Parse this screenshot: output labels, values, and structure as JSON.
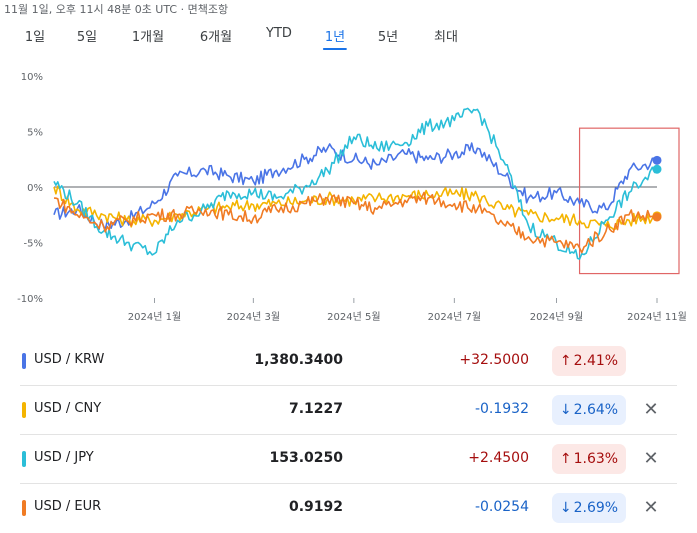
{
  "header": {
    "timestamp": "11월 1일, 오후 11시 48분 0초 UTC · 면책조항"
  },
  "tabs": [
    {
      "label": "1일",
      "active": false
    },
    {
      "label": "5일",
      "active": false
    },
    {
      "label": "1개월",
      "active": false
    },
    {
      "label": "6개월",
      "active": false
    },
    {
      "label": "YTD",
      "active": false
    },
    {
      "label": "1년",
      "active": true
    },
    {
      "label": "5년",
      "active": false
    },
    {
      "label": "최대",
      "active": false
    }
  ],
  "colors": {
    "krw": "#4a74e6",
    "cny": "#f4b400",
    "jpy": "#2bbed8",
    "eur": "#f07b24",
    "highlight_box": "#e06666",
    "up": "#a50e0e",
    "down": "#1a63c7"
  },
  "chart_data": {
    "type": "line",
    "y_unit": "%",
    "ylim": [
      -10,
      10
    ],
    "y_ticks": [
      "10%",
      "5%",
      "0%",
      "-5%",
      "-10%"
    ],
    "x_start": "2023-11-01",
    "x_end": "2024-11-01",
    "x_ticks": [
      "2024년 1월",
      "2024년 3월",
      "2024년 5월",
      "2024년 7월",
      "2024년 9월",
      "2024년 11월"
    ],
    "zero_line": true,
    "highlight_range": [
      "2024-09-15",
      "2024-11-01"
    ],
    "series": [
      {
        "name": "USD / KRW",
        "color": "#4a74e6",
        "x": [
          "2023-11-01",
          "2023-11-15",
          "2023-12-01",
          "2023-12-15",
          "2024-01-01",
          "2024-01-15",
          "2024-02-01",
          "2024-02-15",
          "2024-03-01",
          "2024-03-15",
          "2024-04-01",
          "2024-04-15",
          "2024-05-01",
          "2024-05-15",
          "2024-06-01",
          "2024-06-15",
          "2024-07-01",
          "2024-07-15",
          "2024-08-01",
          "2024-08-15",
          "2024-09-01",
          "2024-09-15",
          "2024-10-01",
          "2024-10-15",
          "2024-11-01"
        ],
        "y": [
          -2.5,
          -2.0,
          -3.5,
          -3.0,
          -1.5,
          1.0,
          1.5,
          1.0,
          0.5,
          1.5,
          2.5,
          3.5,
          2.5,
          2.0,
          3.0,
          2.5,
          3.0,
          3.5,
          1.0,
          -1.0,
          -0.5,
          -1.5,
          -2.0,
          1.5,
          2.4
        ]
      },
      {
        "name": "USD / CNY",
        "color": "#f4b400",
        "x": [
          "2023-11-01",
          "2023-11-15",
          "2023-12-01",
          "2023-12-15",
          "2024-01-01",
          "2024-01-15",
          "2024-02-01",
          "2024-02-15",
          "2024-03-01",
          "2024-03-15",
          "2024-04-01",
          "2024-04-15",
          "2024-05-01",
          "2024-05-15",
          "2024-06-01",
          "2024-06-15",
          "2024-07-01",
          "2024-07-15",
          "2024-08-01",
          "2024-08-15",
          "2024-09-01",
          "2024-09-15",
          "2024-10-01",
          "2024-10-15",
          "2024-11-01"
        ],
        "y": [
          0.0,
          -2.0,
          -2.5,
          -3.0,
          -3.0,
          -2.5,
          -2.0,
          -1.8,
          -1.6,
          -1.5,
          -1.3,
          -1.0,
          -1.2,
          -1.0,
          -0.8,
          -0.7,
          -0.6,
          -0.8,
          -2.0,
          -2.5,
          -2.8,
          -3.0,
          -3.5,
          -3.0,
          -2.6
        ]
      },
      {
        "name": "USD / JPY",
        "color": "#2bbed8",
        "x": [
          "2023-11-01",
          "2023-11-15",
          "2023-12-01",
          "2023-12-15",
          "2024-01-01",
          "2024-01-15",
          "2024-02-01",
          "2024-02-15",
          "2024-03-01",
          "2024-03-15",
          "2024-04-01",
          "2024-04-15",
          "2024-05-01",
          "2024-05-15",
          "2024-06-01",
          "2024-06-15",
          "2024-07-01",
          "2024-07-15",
          "2024-08-01",
          "2024-08-15",
          "2024-09-01",
          "2024-09-15",
          "2024-10-01",
          "2024-10-15",
          "2024-11-01"
        ],
        "y": [
          0.5,
          -1.5,
          -4.0,
          -5.0,
          -6.0,
          -3.0,
          -2.0,
          -0.5,
          -0.5,
          -1.0,
          0.0,
          1.5,
          4.5,
          3.5,
          4.0,
          5.5,
          6.0,
          7.0,
          2.0,
          -3.5,
          -5.0,
          -6.5,
          -3.0,
          -0.5,
          1.6
        ]
      },
      {
        "name": "USD / EUR",
        "color": "#f07b24",
        "x": [
          "2023-11-01",
          "2023-11-15",
          "2023-12-01",
          "2023-12-15",
          "2024-01-01",
          "2024-01-15",
          "2024-02-01",
          "2024-02-15",
          "2024-03-01",
          "2024-03-15",
          "2024-04-01",
          "2024-04-15",
          "2024-05-01",
          "2024-05-15",
          "2024-06-01",
          "2024-06-15",
          "2024-07-01",
          "2024-07-15",
          "2024-08-01",
          "2024-08-15",
          "2024-09-01",
          "2024-09-15",
          "2024-10-01",
          "2024-10-15",
          "2024-11-01"
        ],
        "y": [
          -1.0,
          -2.5,
          -3.5,
          -3.0,
          -2.5,
          -2.5,
          -2.0,
          -2.5,
          -2.8,
          -2.0,
          -1.5,
          -1.0,
          -1.5,
          -2.0,
          -1.2,
          -1.0,
          -1.5,
          -2.0,
          -3.5,
          -4.5,
          -5.0,
          -5.5,
          -4.0,
          -2.5,
          -2.7
        ]
      }
    ]
  },
  "rows": [
    {
      "pair": "USD / KRW",
      "color": "#4a74e6",
      "price": "1,380.3400",
      "change": "+32.5000",
      "direction": "up",
      "arrow": "↑",
      "percent": "2.41%",
      "removable": false
    },
    {
      "pair": "USD / CNY",
      "color": "#f4b400",
      "price": "7.1227",
      "change": "-0.1932",
      "direction": "down",
      "arrow": "↓",
      "percent": "2.64%",
      "removable": true
    },
    {
      "pair": "USD / JPY",
      "color": "#2bbed8",
      "price": "153.0250",
      "change": "+2.4500",
      "direction": "up",
      "arrow": "↑",
      "percent": "1.63%",
      "removable": true
    },
    {
      "pair": "USD / EUR",
      "color": "#f07b24",
      "price": "0.9192",
      "change": "-0.0254",
      "direction": "down",
      "arrow": "↓",
      "percent": "2.69%",
      "removable": true
    }
  ],
  "close_glyph": "✕"
}
